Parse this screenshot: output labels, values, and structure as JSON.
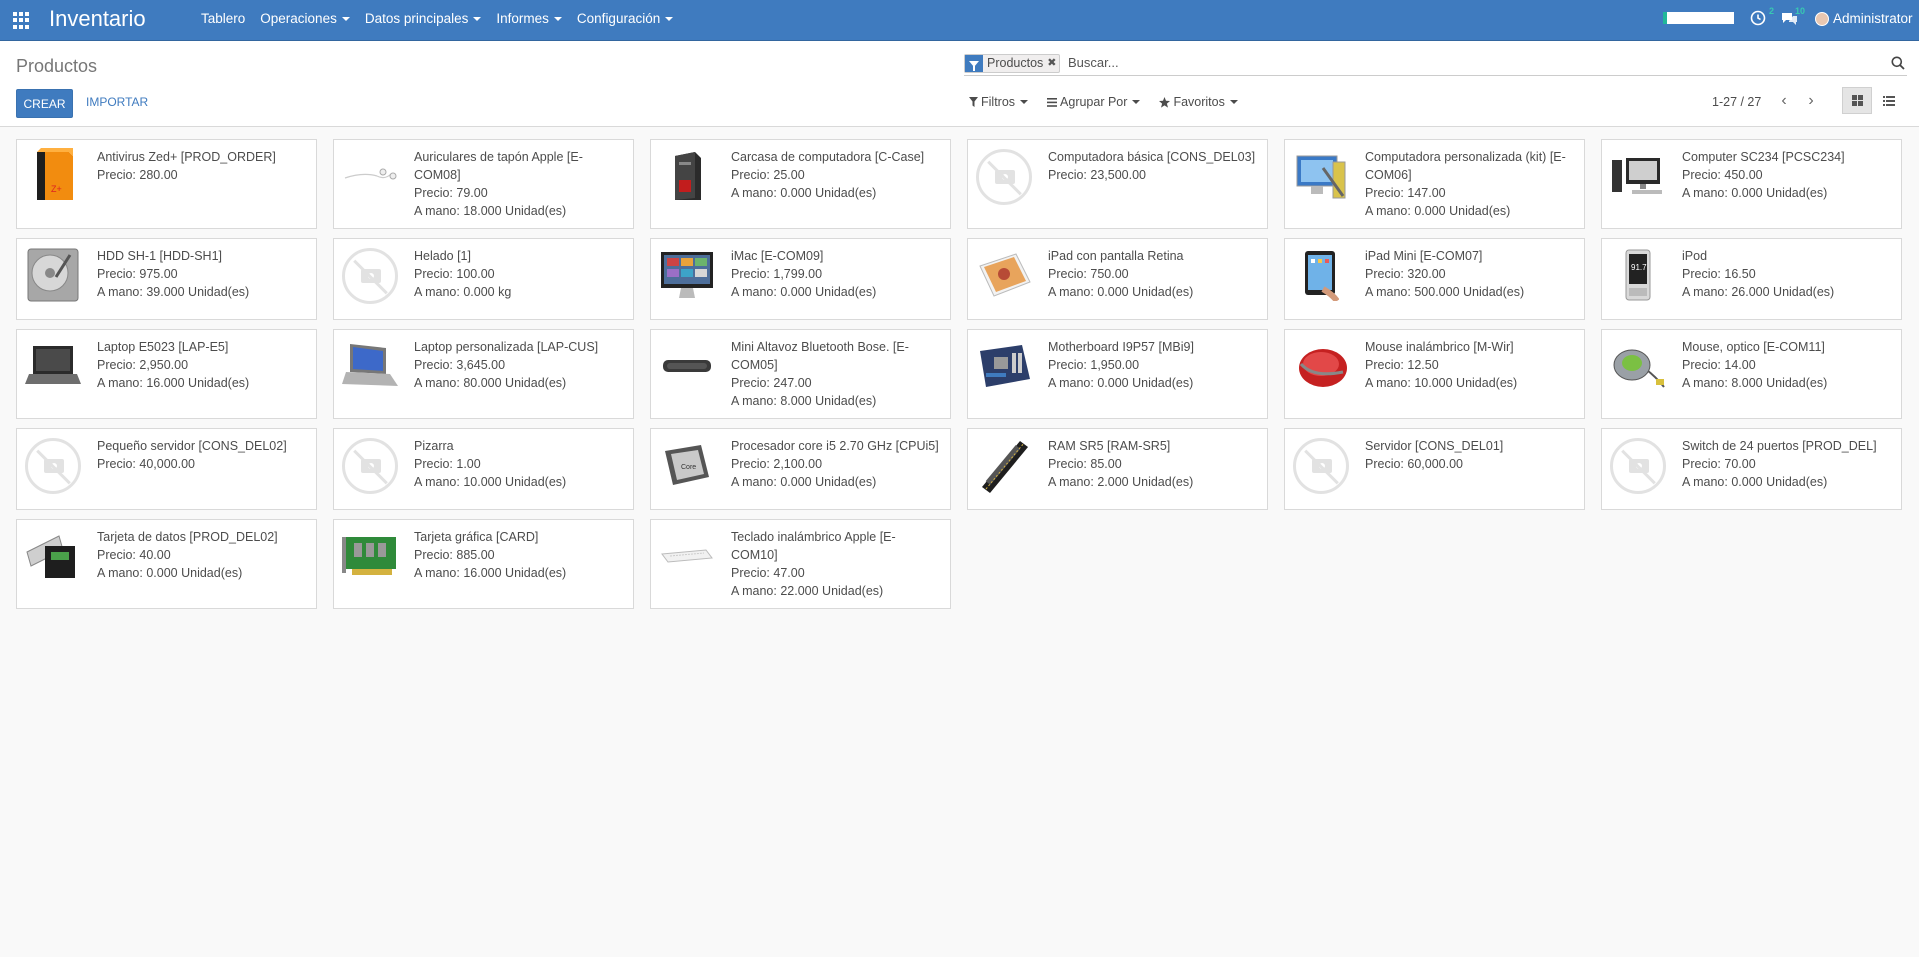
{
  "app": {
    "brand": "Inventario"
  },
  "menu": [
    {
      "label": "Tablero",
      "dropdown": false
    },
    {
      "label": "Operaciones",
      "dropdown": true
    },
    {
      "label": "Datos principales",
      "dropdown": true
    },
    {
      "label": "Informes",
      "dropdown": true
    },
    {
      "label": "Configuración",
      "dropdown": true
    }
  ],
  "systray": {
    "activity_count": "2",
    "messages_count": "10",
    "user": "Administrator"
  },
  "control": {
    "title": "Productos",
    "create_label": "CREAR",
    "import_label": "IMPORTAR",
    "facet_label": "Productos",
    "search_placeholder": "Buscar...",
    "filters_label": "Filtros",
    "groupby_label": "Agrupar Por",
    "favorites_label": "Favoritos",
    "pager": "1-27 / 27"
  },
  "products": [
    {
      "name": "Antivirus Zed+ [PROD_ORDER]",
      "price": "Precio: 280.00",
      "onhand": "",
      "icon": "software-box-icon"
    },
    {
      "name": "Auriculares de tapón Apple [E-COM08]",
      "price": "Precio: 79.00",
      "onhand": "A mano: 18.000 Unidad(es)",
      "icon": "earphones-icon"
    },
    {
      "name": "Carcasa de computadora [C-Case]",
      "price": "Precio: 25.00",
      "onhand": "A mano: 0.000 Unidad(es)",
      "icon": "computer-case-icon"
    },
    {
      "name": "Computadora básica [CONS_DEL03]",
      "price": "Precio: 23,500.00",
      "onhand": "",
      "icon": "placeholder"
    },
    {
      "name": "Computadora personalizada (kit) [E-COM06]",
      "price": "Precio: 147.00",
      "onhand": "A mano: 0.000 Unidad(es)",
      "icon": "computer-kit-icon"
    },
    {
      "name": "Computer SC234 [PCSC234]",
      "price": "Precio: 450.00",
      "onhand": "A mano: 0.000 Unidad(es)",
      "icon": "desktop-computer-icon"
    },
    {
      "name": "HDD SH-1 [HDD-SH1]",
      "price": "Precio: 975.00",
      "onhand": "A mano: 39.000 Unidad(es)",
      "icon": "hard-drive-icon"
    },
    {
      "name": "Helado [1]",
      "price": "Precio: 100.00",
      "onhand": "A mano: 0.000 kg",
      "icon": "placeholder"
    },
    {
      "name": "iMac [E-COM09]",
      "price": "Precio: 1,799.00",
      "onhand": "A mano: 0.000 Unidad(es)",
      "icon": "imac-icon"
    },
    {
      "name": "iPad con pantalla Retina",
      "price": "Precio: 750.00",
      "onhand": "A mano: 0.000 Unidad(es)",
      "icon": "ipad-retina-icon"
    },
    {
      "name": "iPad Mini [E-COM07]",
      "price": "Precio: 320.00",
      "onhand": "A mano: 500.000 Unidad(es)",
      "icon": "ipad-mini-icon"
    },
    {
      "name": "iPod",
      "price": "Precio: 16.50",
      "onhand": "A mano: 26.000 Unidad(es)",
      "icon": "ipod-icon"
    },
    {
      "name": "Laptop E5023 [LAP-E5]",
      "price": "Precio: 2,950.00",
      "onhand": "A mano: 16.000 Unidad(es)",
      "icon": "laptop-icon"
    },
    {
      "name": "Laptop personalizada [LAP-CUS]",
      "price": "Precio: 3,645.00",
      "onhand": "A mano: 80.000 Unidad(es)",
      "icon": "laptop-blue-icon"
    },
    {
      "name": "Mini Altavoz Bluetooth Bose. [E-COM05]",
      "price": "Precio: 247.00",
      "onhand": "A mano: 8.000 Unidad(es)",
      "icon": "speaker-icon"
    },
    {
      "name": "Motherboard I9P57 [MBi9]",
      "price": "Precio: 1,950.00",
      "onhand": "A mano: 0.000 Unidad(es)",
      "icon": "motherboard-icon"
    },
    {
      "name": "Mouse inalámbrico [M-Wir]",
      "price": "Precio: 12.50",
      "onhand": "A mano: 10.000 Unidad(es)",
      "icon": "wireless-mouse-icon"
    },
    {
      "name": "Mouse, optico [E-COM11]",
      "price": "Precio: 14.00",
      "onhand": "A mano: 8.000 Unidad(es)",
      "icon": "optical-mouse-icon"
    },
    {
      "name": "Pequeño servidor [CONS_DEL02]",
      "price": "Precio: 40,000.00",
      "onhand": "",
      "icon": "placeholder"
    },
    {
      "name": "Pizarra",
      "price": "Precio: 1.00",
      "onhand": "A mano: 10.000 Unidad(es)",
      "icon": "placeholder"
    },
    {
      "name": "Procesador core i5 2.70 GHz [CPUi5]",
      "price": "Precio: 2,100.00",
      "onhand": "A mano: 0.000 Unidad(es)",
      "icon": "cpu-icon"
    },
    {
      "name": "RAM SR5 [RAM-SR5]",
      "price": "Precio: 85.00",
      "onhand": "A mano: 2.000 Unidad(es)",
      "icon": "ram-icon"
    },
    {
      "name": "Servidor [CONS_DEL01]",
      "price": "Precio: 60,000.00",
      "onhand": "",
      "icon": "placeholder"
    },
    {
      "name": "Switch de 24 puertos [PROD_DEL]",
      "price": "Precio: 70.00",
      "onhand": "A mano: 0.000 Unidad(es)",
      "icon": "placeholder"
    },
    {
      "name": "Tarjeta de datos [PROD_DEL02]",
      "price": "Precio: 40.00",
      "onhand": "A mano: 0.000 Unidad(es)",
      "icon": "data-card-icon"
    },
    {
      "name": "Tarjeta gráfica [CARD]",
      "price": "Precio: 885.00",
      "onhand": "A mano: 16.000 Unidad(es)",
      "icon": "graphics-card-icon"
    },
    {
      "name": "Teclado inalámbrico Apple [E-COM10]",
      "price": "Precio: 47.00",
      "onhand": "A mano: 22.000 Unidad(es)",
      "icon": "keyboard-icon"
    }
  ]
}
